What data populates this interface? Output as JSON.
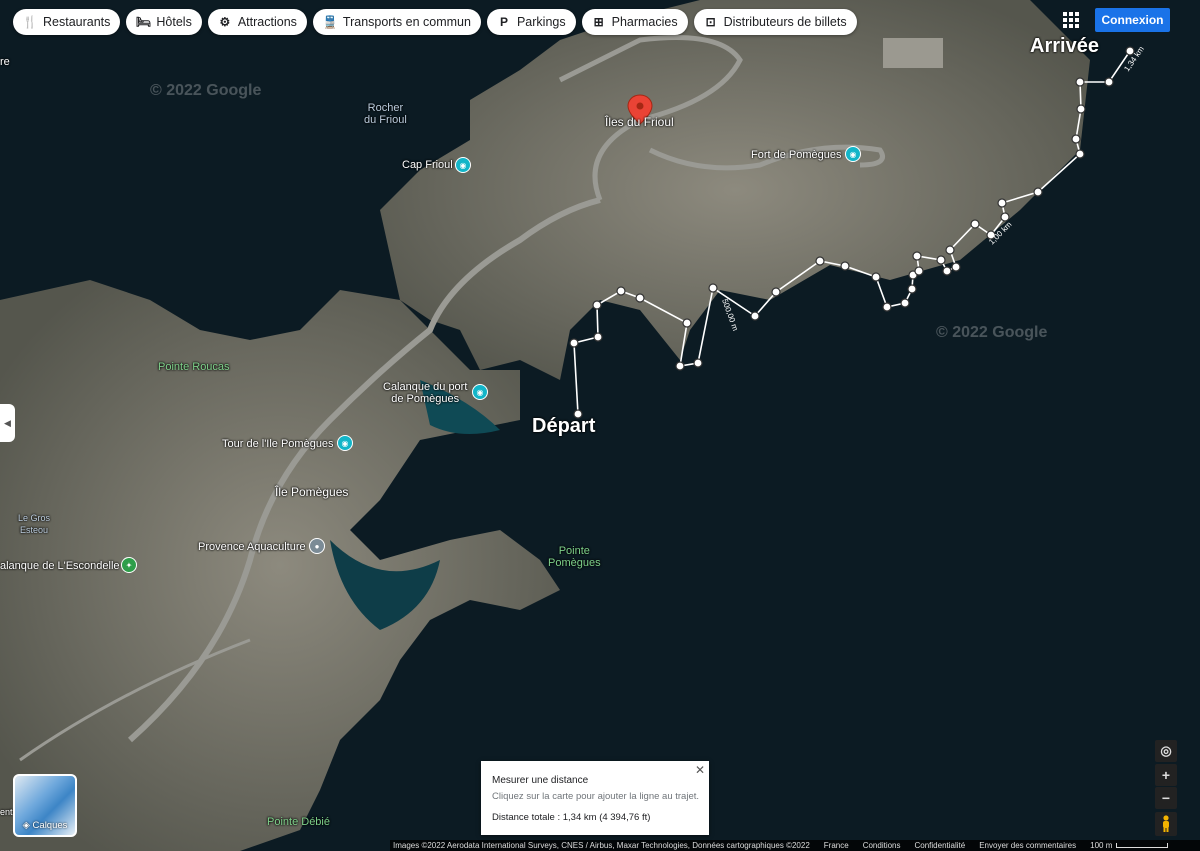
{
  "chips": [
    {
      "icon": "restaurant-icon",
      "glyph": "🍴",
      "label": "Restaurants"
    },
    {
      "icon": "hotel-icon",
      "glyph": "🛏",
      "label": "Hôtels"
    },
    {
      "icon": "attractions-icon",
      "glyph": "⚙",
      "label": "Attractions"
    },
    {
      "icon": "transit-icon",
      "glyph": "🚆",
      "label": "Transports en commun"
    },
    {
      "icon": "parking-icon",
      "glyph": "P",
      "label": "Parkings"
    },
    {
      "icon": "pharmacy-icon",
      "glyph": "⊞",
      "label": "Pharmacies"
    },
    {
      "icon": "atm-icon",
      "glyph": "⊡",
      "label": "Distributeurs de billets"
    }
  ],
  "header": {
    "login_label": "Connexion"
  },
  "map": {
    "watermarks": [
      "© 2022 Google",
      "© 2022 Google"
    ],
    "labels": {
      "rocher_frioul": "Rocher\ndu Frioul",
      "cap_frioul": "Cap Frioul",
      "iles_frioul": "Îles du Frioul",
      "fort_pomegues": "Fort de Pomègues",
      "pointe_roucas": "Pointe Roucas",
      "calanque_port": "Calanque du port\nde Pomègues",
      "tour_ile": "Tour de l'Ile Pomègues",
      "ile_pomegues": "Île Pomègues",
      "gros_esteou": "Le Gros\nEsteou",
      "provence_aqua": "Provence Aquaculture",
      "calanque_escondelle": "alanque de L'Escondelle",
      "pointe_pomegues": "Pointe\nPomègues",
      "pointe_debie": "Pointe Débié",
      "depart": "Départ",
      "arrivee": "Arrivée",
      "edge_left_1": "re",
      "edge_left_2": "ent"
    },
    "distance_marks": {
      "m500": "500,00 m",
      "km1": "1,00 km",
      "km134": "1,34 km"
    }
  },
  "measure_panel": {
    "title": "Mesurer une distance",
    "hint": "Cliquez sur la carte pour ajouter la ligne au trajet.",
    "total": "Distance totale : 1,34 km (4 394,76 ft)",
    "close": "✕"
  },
  "layers": {
    "label": "Calques"
  },
  "footer": {
    "imagery": "Images ©2022 Aerodata International Surveys, CNES / Airbus, Maxar Technologies, Données cartographiques ©2022",
    "country": "France",
    "terms": "Conditions",
    "privacy": "Confidentialité",
    "feedback": "Envoyer des commentaires",
    "scale": "100 m"
  },
  "colors": {
    "accent": "#1a73e8",
    "poi_attraction": "#13b5c8",
    "pin": "#ea4335"
  }
}
